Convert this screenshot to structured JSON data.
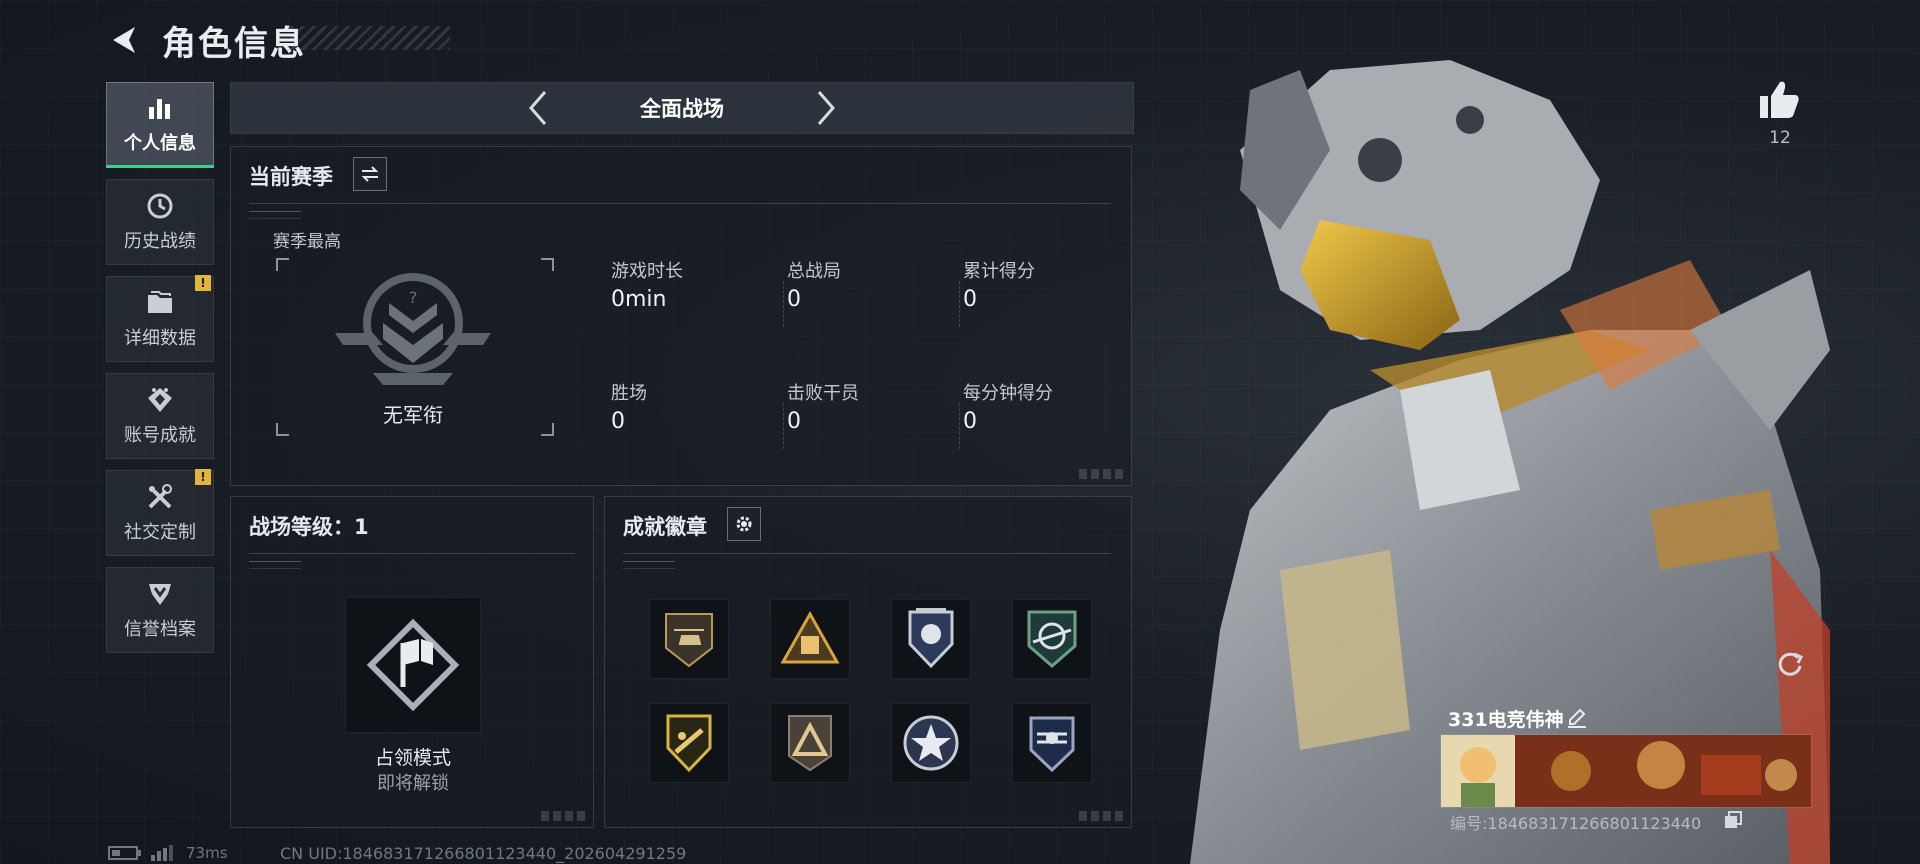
{
  "header": {
    "title": "角色信息"
  },
  "nav": {
    "items": [
      {
        "label": "个人信息",
        "active": true,
        "icon": "bar-chart-icon"
      },
      {
        "label": "历史战绩",
        "icon": "clock-icon"
      },
      {
        "label": "详细数据",
        "icon": "folder-icon",
        "badge": "!"
      },
      {
        "label": "账号成就",
        "icon": "achievement-icon"
      },
      {
        "label": "社交定制",
        "icon": "tools-icon",
        "badge": "!"
      },
      {
        "label": "信誉档案",
        "icon": "shield-icon"
      }
    ]
  },
  "mode": {
    "title": "全面战场"
  },
  "season": {
    "title": "当前赛季",
    "best_label": "赛季最高",
    "rank_name": "无军衔",
    "stats": [
      {
        "label": "游戏时长",
        "value": "0min"
      },
      {
        "label": "总战局",
        "value": "0"
      },
      {
        "label": "累计得分",
        "value": "0"
      },
      {
        "label": "胜场",
        "value": "0"
      },
      {
        "label": "击败干员",
        "value": "0"
      },
      {
        "label": "每分钟得分",
        "value": "0"
      }
    ]
  },
  "battlefield": {
    "title": "战场等级：1",
    "mode_name": "占领模式",
    "mode_status": "即将解锁"
  },
  "badges": {
    "title": "成就徽章",
    "items": [
      "helicopter-badge",
      "pyramid-badge",
      "eagle-shield-badge",
      "planet-badge",
      "weapon-badge",
      "triangle-badge",
      "star-badge",
      "emblem-badge"
    ]
  },
  "profile": {
    "likes": "12",
    "name": "331电竞伟神",
    "id": "编号:1846831712668011234​40"
  },
  "footer": {
    "ping": "73ms",
    "uid": "CN UID:1846831712668011234​40_202604291259"
  },
  "colors": {
    "accent": "#3fd08a",
    "badge": "#e4b53b",
    "visor": "#d4a12a"
  }
}
